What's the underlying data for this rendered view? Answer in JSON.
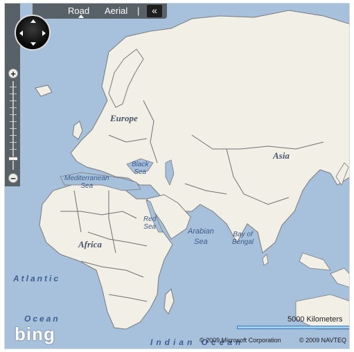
{
  "topbar": {
    "tabs": [
      {
        "label": "Road",
        "active": true
      },
      {
        "label": "Aerial",
        "active": false
      }
    ],
    "separator": "|",
    "collapse_glyph": "«",
    "collapse_icon": "double-chevron-left-icon"
  },
  "navigation": {
    "compass_icon": "pan-compass-icon",
    "zoom_in_label": "+",
    "zoom_out_label": "−",
    "zoom_level_fraction": 0.2
  },
  "map": {
    "style": "Road",
    "labels": {
      "europe": "Europe",
      "asia": "Asia",
      "africa": "Africa",
      "black_sea": [
        "Black",
        "Sea"
      ],
      "mediterranean_sea": [
        "Mediterranean",
        "Sea"
      ],
      "red_sea": [
        "Red",
        "Sea"
      ],
      "arabian_sea": [
        "Arabian",
        "Sea"
      ],
      "bay_of_bengal": [
        "Bay of",
        "Bengal"
      ],
      "atlantic": "Atlantic",
      "ocean_left": "Ocean",
      "indian_ocean": "Indian Ocean"
    },
    "colors": {
      "water": "#a7c0dc",
      "land": "#f1efe6",
      "border": "#6f6f6f"
    }
  },
  "footer": {
    "logo_text": "bing",
    "scale_label": "5000 Kilometers",
    "copyright_microsoft": "© 2009 Microsoft Corporation",
    "copyright_navteq": "© 2009 NAVTEQ"
  }
}
